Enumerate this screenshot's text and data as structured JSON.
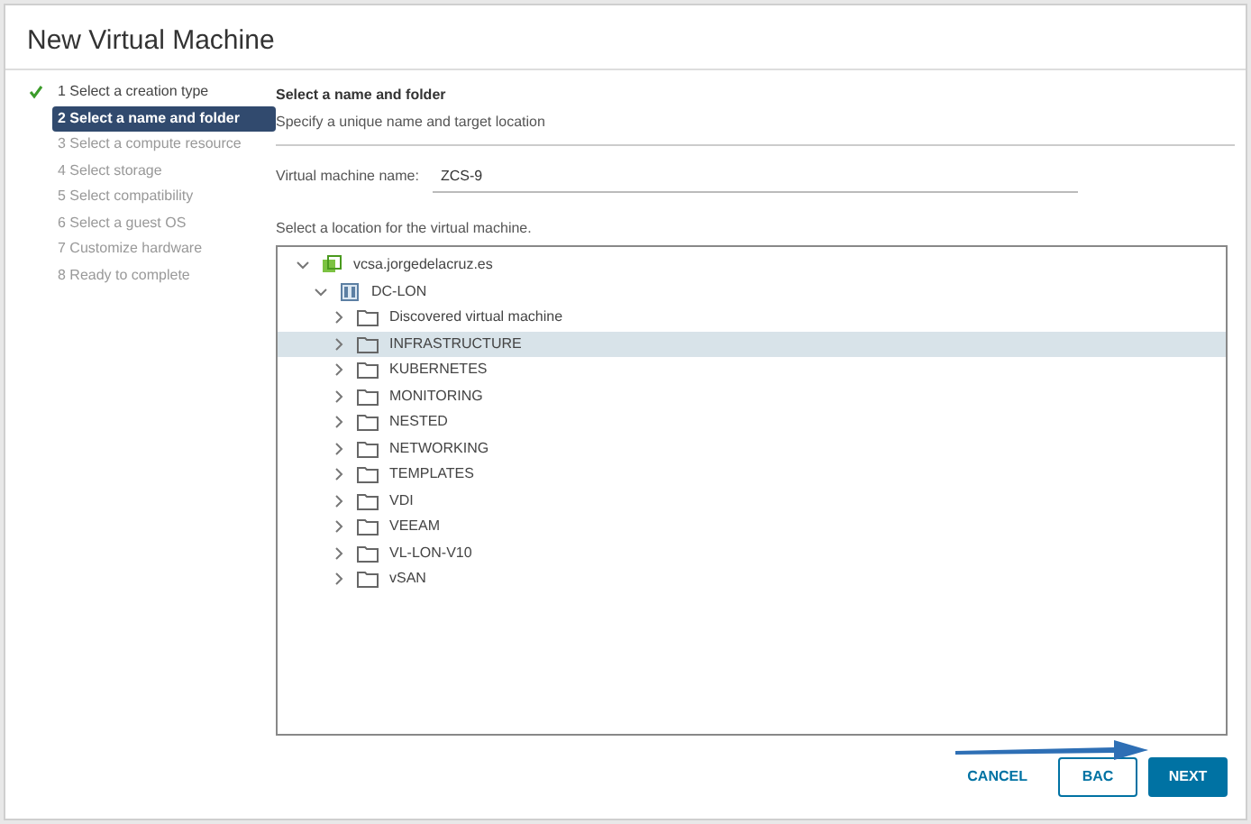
{
  "dialog": {
    "title": "New Virtual Machine"
  },
  "steps": [
    {
      "label": "1 Select a creation type",
      "completed": true,
      "selected": false
    },
    {
      "label": "2 Select a name and folder",
      "completed": false,
      "selected": true
    },
    {
      "label": "3 Select a compute resource",
      "completed": false,
      "selected": false
    },
    {
      "label": "4 Select storage",
      "completed": false,
      "selected": false
    },
    {
      "label": "5 Select compatibility",
      "completed": false,
      "selected": false
    },
    {
      "label": "6 Select a guest OS",
      "completed": false,
      "selected": false
    },
    {
      "label": "7 Customize hardware",
      "completed": false,
      "selected": false
    },
    {
      "label": "8 Ready to complete",
      "completed": false,
      "selected": false
    }
  ],
  "header": {
    "title": "Select a name and folder",
    "subtitle": "Specify a unique name and target location"
  },
  "name_field": {
    "label": "Virtual machine name:",
    "value": "ZCS-9"
  },
  "location_label": "Select a location for the virtual machine.",
  "tree": [
    {
      "label": "vcsa.jorgedelacruz.es",
      "kind": "vcenter",
      "expanded": true,
      "selected": false,
      "children": [
        {
          "label": "DC-LON",
          "kind": "datacenter",
          "expanded": true,
          "selected": false,
          "children": [
            {
              "label": "Discovered virtual machine",
              "kind": "folder",
              "expanded": false,
              "selected": false
            },
            {
              "label": "INFRASTRUCTURE",
              "kind": "folder",
              "expanded": false,
              "selected": true
            },
            {
              "label": "KUBERNETES",
              "kind": "folder",
              "expanded": false,
              "selected": false
            },
            {
              "label": "MONITORING",
              "kind": "folder",
              "expanded": false,
              "selected": false
            },
            {
              "label": "NESTED",
              "kind": "folder",
              "expanded": false,
              "selected": false
            },
            {
              "label": "NETWORKING",
              "kind": "folder",
              "expanded": false,
              "selected": false
            },
            {
              "label": "TEMPLATES",
              "kind": "folder",
              "expanded": false,
              "selected": false
            },
            {
              "label": "VDI",
              "kind": "folder",
              "expanded": false,
              "selected": false
            },
            {
              "label": "VEEAM",
              "kind": "folder",
              "expanded": false,
              "selected": false
            },
            {
              "label": "VL-LON-V10",
              "kind": "folder",
              "expanded": false,
              "selected": false
            },
            {
              "label": "vSAN",
              "kind": "folder",
              "expanded": false,
              "selected": false
            }
          ]
        }
      ]
    }
  ],
  "buttons": [
    {
      "label": "CANCEL",
      "kind": "flat"
    },
    {
      "label": "BAC",
      "kind": "outline"
    },
    {
      "label": "NEXT",
      "kind": "primary"
    }
  ]
}
